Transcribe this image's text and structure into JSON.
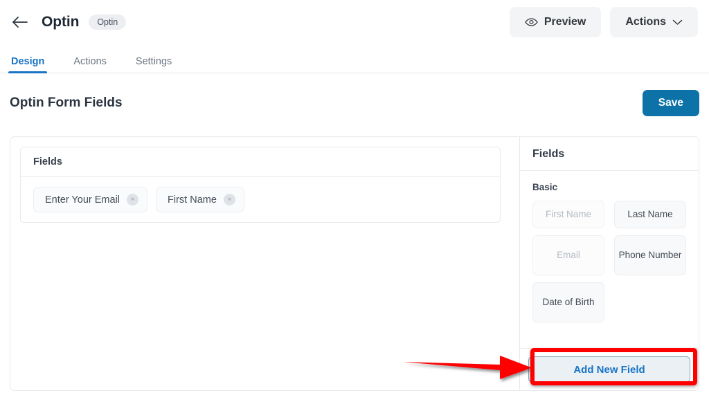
{
  "header": {
    "back_icon": "arrow-left-icon",
    "page_name": "Optin",
    "type_badge": "Optin",
    "preview_label": "Preview",
    "preview_icon": "eye-icon",
    "actions_label": "Actions",
    "actions_icon": "chevron-down-icon"
  },
  "tabs": [
    {
      "label": "Design",
      "active": true
    },
    {
      "label": "Actions",
      "active": false
    },
    {
      "label": "Settings",
      "active": false
    }
  ],
  "title_row": {
    "title": "Optin Form Fields",
    "save_label": "Save"
  },
  "canvas": {
    "fields_box_title": "Fields",
    "chips": [
      {
        "label": "Enter Your Email",
        "remove_icon": "close-icon",
        "remove_glyph": "×"
      },
      {
        "label": "First Name",
        "remove_icon": "close-icon",
        "remove_glyph": "×"
      }
    ]
  },
  "sidebar": {
    "title": "Fields",
    "group_label": "Basic",
    "field_buttons": [
      {
        "label": "First Name",
        "disabled": true
      },
      {
        "label": "Last Name",
        "disabled": false
      },
      {
        "label": "Email",
        "disabled": true
      },
      {
        "label": "Phone Number",
        "disabled": false
      },
      {
        "label": "Date of Birth",
        "disabled": false
      }
    ],
    "add_new_field_label": "Add New Field"
  },
  "annotations": {
    "highlight_color": "#ff0000",
    "arrow_color": "#ff0000",
    "arrow_name": "red-arrow-pointing-to-add-new-field",
    "rect_name": "red-highlight-box-around-add-new-field"
  },
  "colors": {
    "accent_blue": "#1874c6",
    "save_blue": "#0d72a8",
    "annotation_red": "#ff0000",
    "badge_grey": "#eceef1"
  }
}
